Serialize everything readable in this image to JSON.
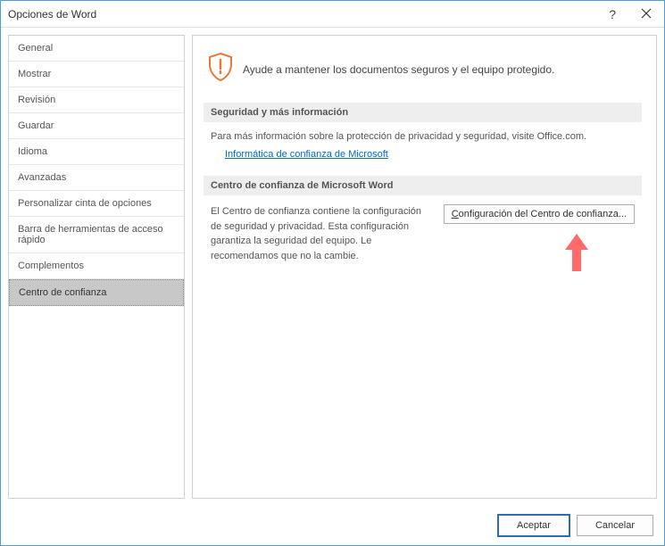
{
  "window": {
    "title": "Opciones de Word",
    "help": "?",
    "close": "×"
  },
  "sidebar": {
    "items": [
      {
        "label": "General"
      },
      {
        "label": "Mostrar"
      },
      {
        "label": "Revisión"
      },
      {
        "label": "Guardar"
      },
      {
        "label": "Idioma"
      },
      {
        "label": "Avanzadas"
      },
      {
        "label": "Personalizar cinta de opciones"
      },
      {
        "label": "Barra de herramientas de acceso rápido"
      },
      {
        "label": "Complementos"
      },
      {
        "label": "Centro de confianza"
      }
    ]
  },
  "content": {
    "banner": "Ayude a mantener los documentos seguros y el equipo protegido.",
    "section1": {
      "header": "Seguridad y más información",
      "text": "Para más información sobre la protección de privacidad y seguridad, visite Office.com.",
      "link": "Informática de confianza de Microsoft"
    },
    "section2": {
      "header": "Centro de confianza de Microsoft Word",
      "text": "El Centro de confianza contiene la configuración de seguridad y privacidad. Esta configuración garantiza la seguridad del equipo. Le recomendamos que no la cambie.",
      "button_char": "C",
      "button_rest": "onfiguración del Centro de confianza..."
    }
  },
  "footer": {
    "ok": "Aceptar",
    "cancel": "Cancelar"
  }
}
